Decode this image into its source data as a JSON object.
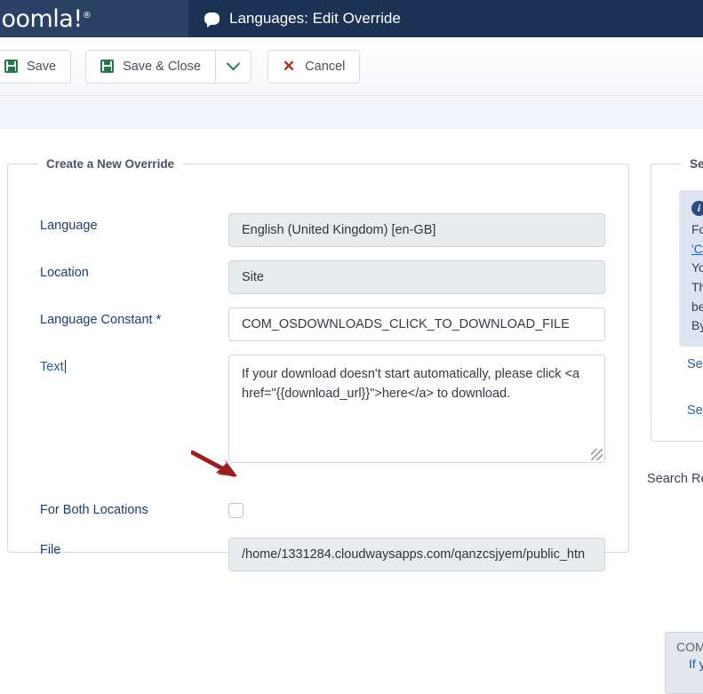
{
  "header": {
    "brand": "Joomla!",
    "brand_sup": "®",
    "page_title": "Languages: Edit Override",
    "bubble_icon": "speech-bubble-icon",
    "brand_bg": "#2a4163",
    "header_bg": "#1c3255"
  },
  "toolbar": {
    "save_label": "Save",
    "save_close_label": "Save & Close",
    "cancel_label": "Cancel",
    "dropdown_icon": "chevron-down-icon",
    "save_icon": "floppy-disk-icon",
    "cancel_icon": "close-x-icon",
    "save_icon_color": "#207a49",
    "cancel_icon_color": "#b82424"
  },
  "main_panel": {
    "legend": "Create a New Override",
    "fields": {
      "language": {
        "label": "Language",
        "value": "English (United Kingdom) [en-GB]",
        "readonly": true
      },
      "location": {
        "label": "Location",
        "value": "Site",
        "readonly": true
      },
      "constant": {
        "label": "Language Constant *",
        "value": "COM_OSDOWNLOADS_CLICK_TO_DOWNLOAD_FILE",
        "readonly": false
      },
      "text": {
        "label": "Text",
        "value": "If your download doesn't start automatically, please click <a href=\"{{download_url}}\">here</a> to download.",
        "focused": true
      },
      "both_locations": {
        "label": "For Both Locations",
        "checked": false
      },
      "file": {
        "label": "File",
        "value": "/home/1331284.cloudwaysapps.com/qanzcsjyem/public_htn",
        "readonly": true
      }
    }
  },
  "side_panel": {
    "legend": "Se",
    "info_icon": "info-circle-icon",
    "info_lines": [
      "Fo",
      "'C",
      "Yo",
      "Th",
      "be",
      "By"
    ],
    "info_link": "C",
    "links": [
      "Sear",
      "Sear"
    ],
    "search_results_label": "Search Re",
    "result_box": {
      "constant": "COM_O",
      "text": "If yo"
    }
  },
  "annotation": {
    "arrow": "pointer-arrow",
    "color": "#9c1f1f"
  }
}
